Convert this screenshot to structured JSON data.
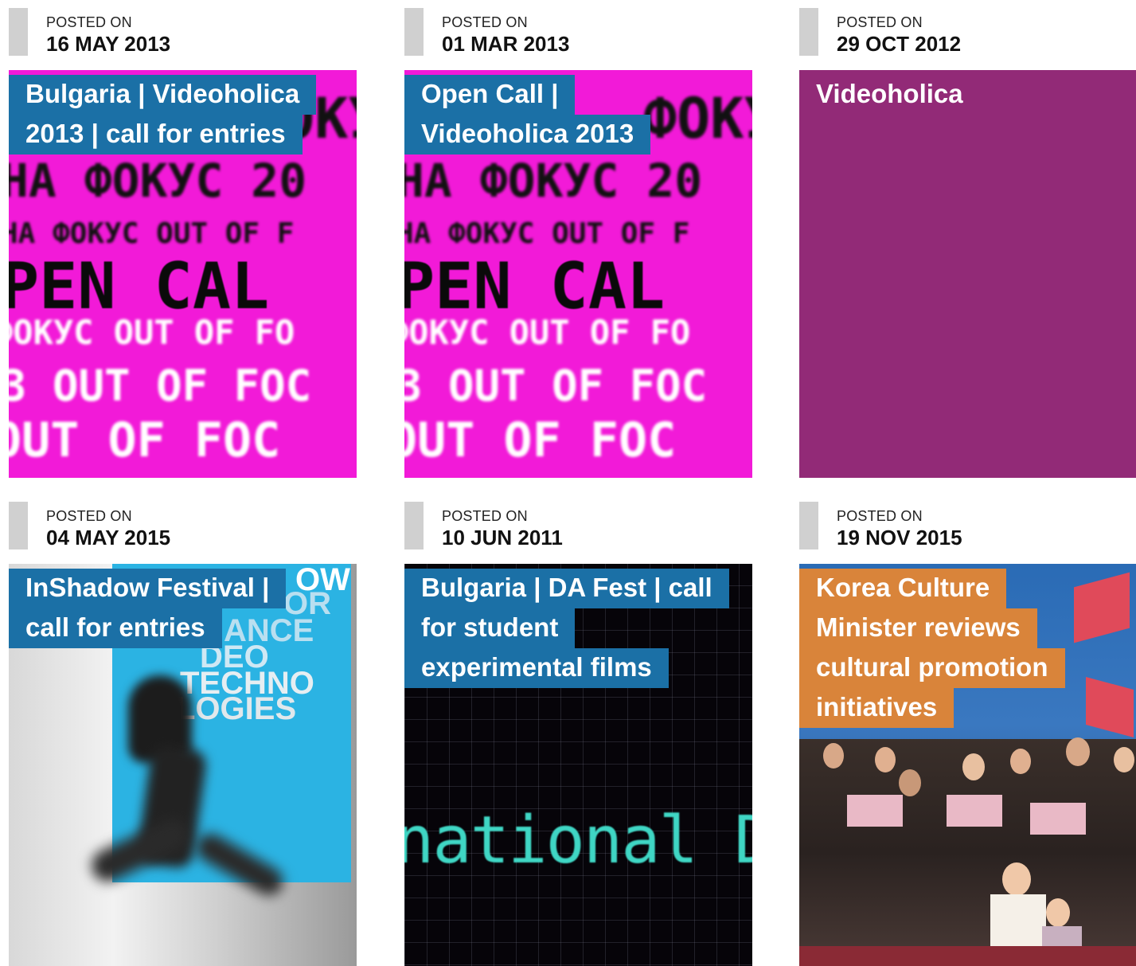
{
  "posts": [
    {
      "posted_label": "POSTED ON",
      "date": "16 MAY 2013",
      "title_lines": [
        "Bulgaria | Videoholica",
        "2013 | call for entries"
      ],
      "art_text": [
        "ФОКУС",
        "НА ФОКУС 20",
        "НА ФОКУС OUT OF F",
        "PEN CAL",
        "ФОКУС OUT OF FO",
        "3 OUT OF FOC",
        "OUT OF FOC"
      ]
    },
    {
      "posted_label": "POSTED ON",
      "date": "01 MAR 2013",
      "title_lines": [
        "Open Call |",
        "Videoholica 2013"
      ],
      "art_text": [
        "ФОКУС",
        "НА ФОКУС 20",
        "НА ФОКУС OUT OF F",
        "PEN CAL",
        "ФОКУС OUT OF FO",
        "3 OUT OF FOC",
        "OUT OF FOC"
      ]
    },
    {
      "posted_label": "POSTED ON",
      "date": "29 OCT 2012",
      "title_lines": [
        "Videoholica"
      ],
      "color": "#922a77"
    },
    {
      "posted_label": "POSTED ON",
      "date": "04 MAY 2015",
      "title_lines": [
        "InShadow Festival |",
        "call for entries"
      ],
      "art_text": [
        "OW",
        "OR",
        "ANCE",
        "DEO",
        "TECHNO",
        "LOGIES"
      ]
    },
    {
      "posted_label": "POSTED ON",
      "date": "10 JUN 2011",
      "title_lines": [
        "Bulgaria | DA Fest | call",
        "for student",
        "experimental films"
      ],
      "art_text": [
        "national DI"
      ]
    },
    {
      "posted_label": "POSTED ON",
      "date": "19 NOV 2015",
      "title_lines": [
        "Korea Culture",
        "Minister reviews",
        "cultural promotion",
        "initiatives"
      ]
    }
  ],
  "colors": {
    "title_blue": "#1b70a6",
    "title_orange": "#d9843a",
    "pink": "#f21ad8",
    "purple": "#922a77"
  }
}
